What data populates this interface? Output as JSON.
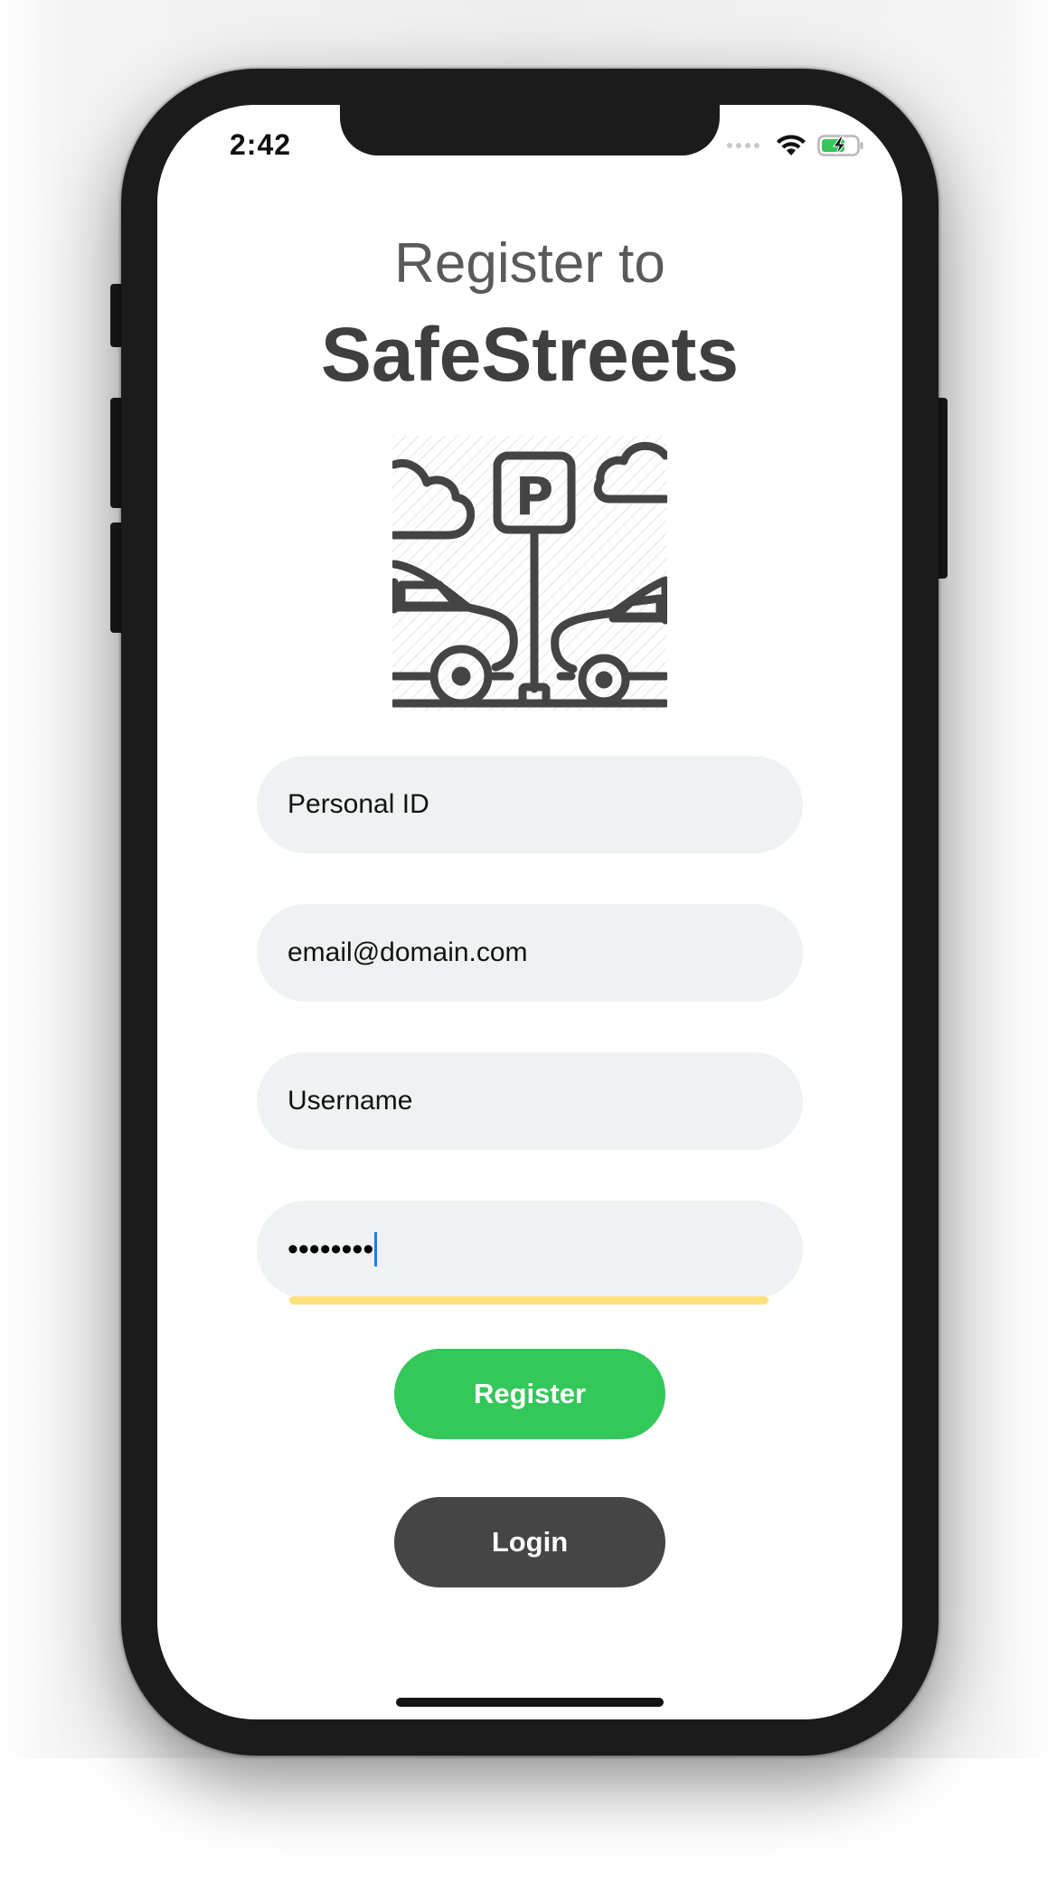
{
  "status_bar": {
    "time": "2:42",
    "icons": [
      "cellular-signal-icon",
      "wifi-icon",
      "battery-charging-icon"
    ]
  },
  "header": {
    "line1": "Register to",
    "line2": "SafeStreets"
  },
  "illustration": {
    "name": "parking-street-illustration",
    "parking_sign_letter": "P"
  },
  "form": {
    "personal_id": {
      "value": "",
      "placeholder": "Personal ID"
    },
    "email": {
      "value": "",
      "placeholder": "email@domain.com"
    },
    "username": {
      "value": "",
      "placeholder": "Username"
    },
    "password": {
      "masked_value": "••••••••"
    }
  },
  "actions": {
    "register_label": "Register",
    "login_label": "Login"
  },
  "colors": {
    "register": "#34c759",
    "login": "#454545",
    "field_background": "#eff2f3",
    "focus_underline": "#fde07a",
    "caret": "#1a7cf2",
    "title": "#3f3f3f"
  }
}
